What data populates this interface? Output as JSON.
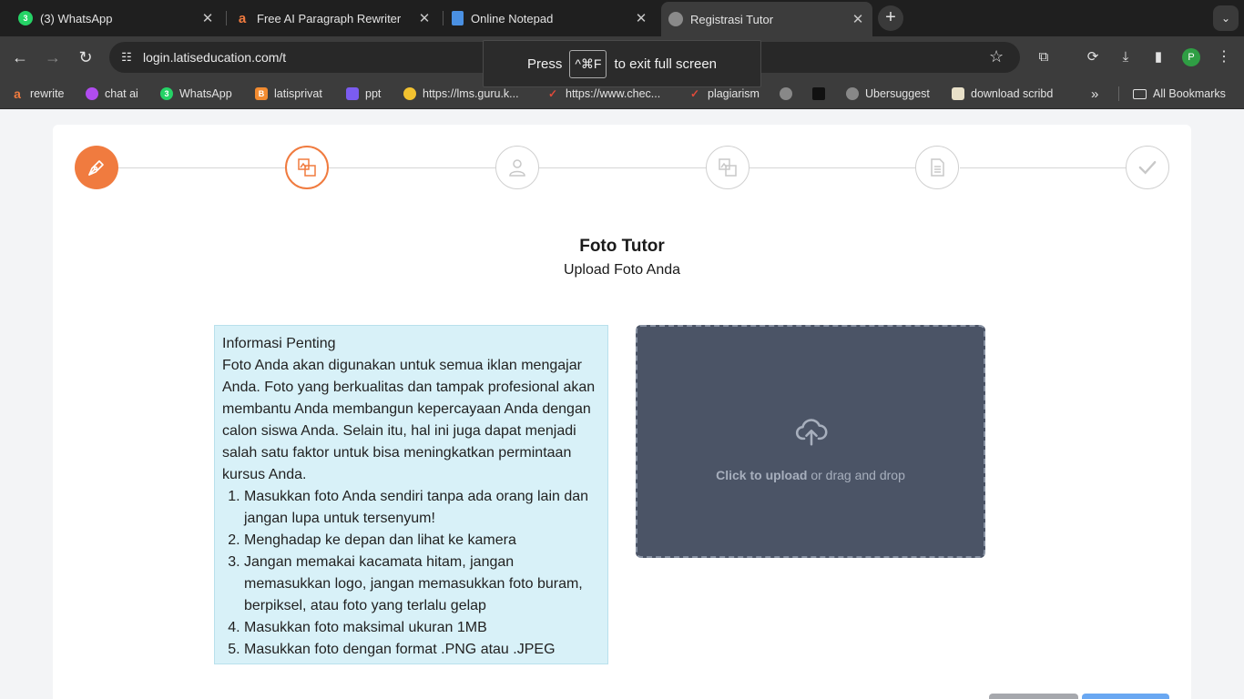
{
  "browser": {
    "tabs": [
      {
        "title": "(3) WhatsApp",
        "badge": "3",
        "icon": "whatsapp-icon"
      },
      {
        "title": "Free AI Paragraph Rewriter",
        "icon": "rewriter-icon"
      },
      {
        "title": "Online Notepad",
        "icon": "notepad-icon"
      },
      {
        "title": "Registrasi Tutor",
        "icon": "globe-icon"
      }
    ],
    "url": "login.latiseducation.com/t",
    "profile_initial": "P",
    "fullscreen_notice": {
      "press": "Press",
      "key": "^⌘F",
      "suffix": "to exit full screen"
    },
    "bookmarks": [
      {
        "label": "rewrite"
      },
      {
        "label": "chat ai"
      },
      {
        "label": "WhatsApp",
        "badge": "3"
      },
      {
        "label": "latisprivat"
      },
      {
        "label": "ppt"
      },
      {
        "label": "https://lms.guru.k..."
      },
      {
        "label": "https://www.chec..."
      },
      {
        "label": "plagiarism"
      },
      {
        "label": "Ubersuggest"
      },
      {
        "label": "download scribd"
      },
      {
        "label": "All Bookmarks"
      }
    ]
  },
  "page": {
    "title": "Foto Tutor",
    "subtitle": "Upload Foto Anda",
    "info": {
      "heading": "Informasi Penting",
      "body": "Foto Anda akan digunakan untuk semua iklan mengajar Anda. Foto yang berkualitas dan tampak profesional akan membantu Anda membangun kepercayaan Anda dengan calon siswa Anda. Selain itu, hal ini juga dapat menjadi salah satu faktor untuk bisa meningkatkan permintaan kursus Anda.",
      "items": [
        "Masukkan foto Anda sendiri tanpa ada orang lain dan jangan lupa untuk tersenyum!",
        "Menghadap ke depan dan lihat ke kamera",
        "Jangan memakai kacamata hitam, jangan memasukkan logo, jangan memasukkan foto buram, berpiksel, atau foto yang terlalu gelap",
        "Masukkan foto maksimal ukuran 1MB",
        "Masukkan foto dengan format .PNG atau .JPEG"
      ]
    },
    "upload": {
      "click_label": "Click to upload",
      "rest_label": "or drag and drop"
    },
    "colors": {
      "accent": "#f07b3f",
      "info_bg": "#d8f1f8",
      "upload_bg": "#4b5466"
    }
  }
}
